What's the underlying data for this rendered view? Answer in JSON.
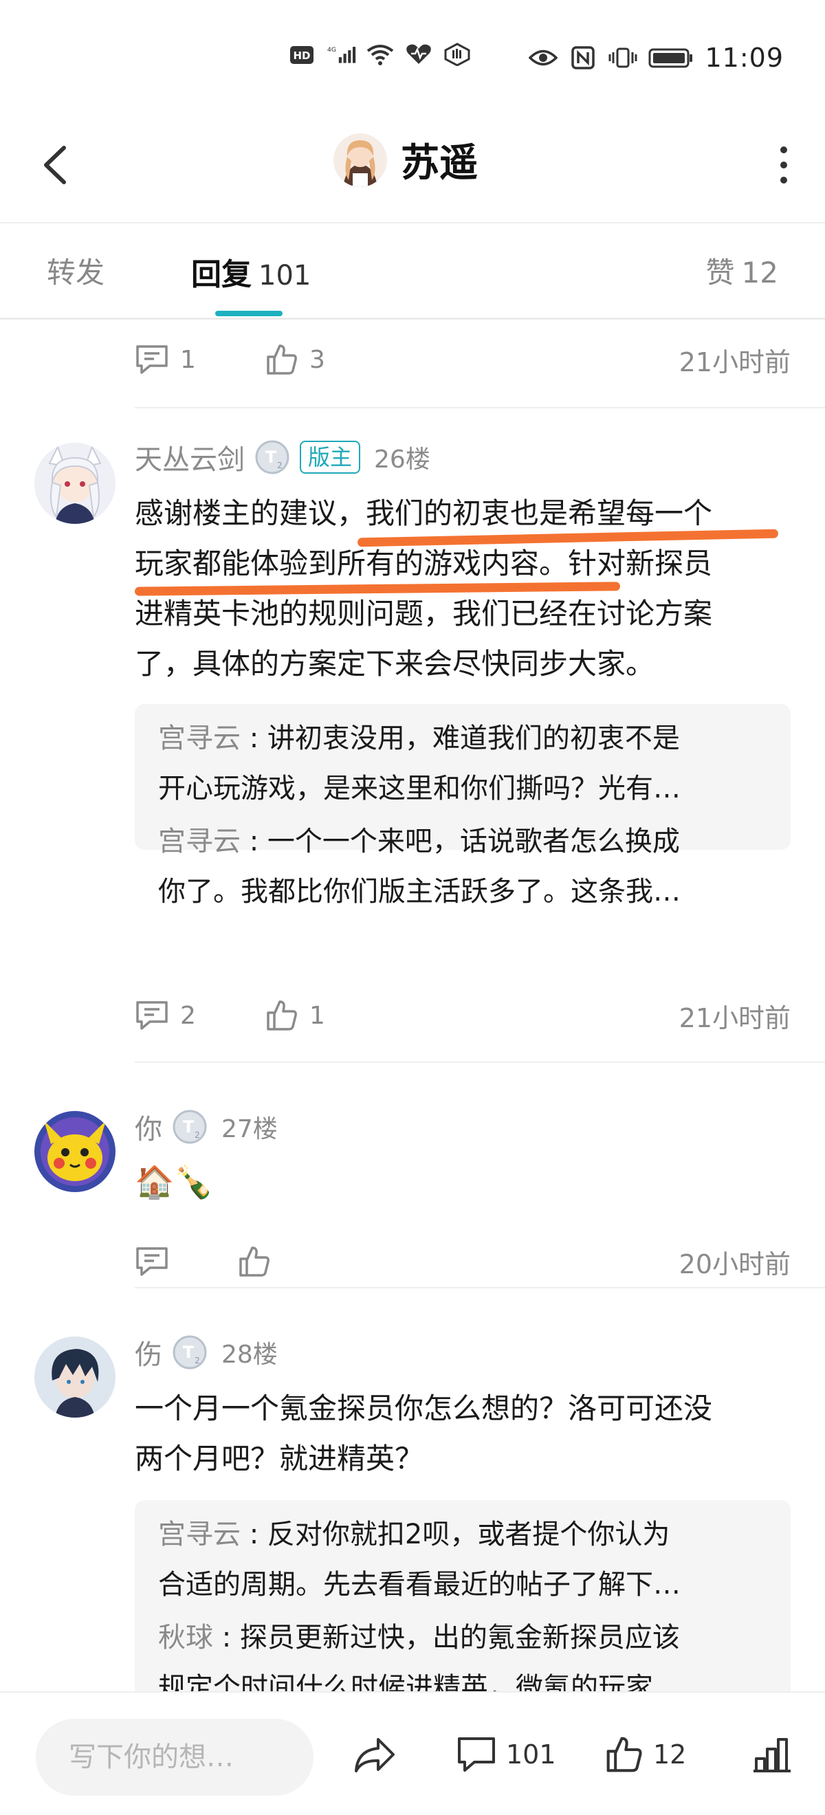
{
  "status_bar": {
    "icons_left": [
      "hd-icon",
      "signal-4g-icon",
      "wifi-icon",
      "heart-health-icon",
      "hand-icon"
    ],
    "icons_right": [
      "eye-comfort-icon",
      "nfc-icon",
      "vibrate-icon",
      "battery-icon"
    ],
    "time": "11:09"
  },
  "header": {
    "title": "苏遥",
    "back_icon": "chevron-left-icon",
    "more_icon": "more-vertical-icon"
  },
  "tabs": {
    "forward": "转发",
    "reply": "回复",
    "reply_count": "101",
    "like": "赞",
    "like_count": "12",
    "accent": "#1eb1c0"
  },
  "top_actions": {
    "comments": "1",
    "likes": "3",
    "time": "21小时前"
  },
  "posts": [
    {
      "author": "天丛云剑",
      "role": "版主",
      "floor": "26楼",
      "lines": [
        "感谢楼主的建议，我们的初衷也是希望每一个",
        "玩家都能体验到所有的游戏内容。针对新探员",
        "进精英卡池的规则问题，我们已经在讨论方案",
        "了，具体的方案定下来会尽快同步大家。"
      ],
      "replies": [
        {
          "name": "宫寻云",
          "line1": "讲初衷没用，难道我们的初衷不是",
          "line2": "开心玩游戏，是来这里和你们撕吗？光有…"
        },
        {
          "name": "宫寻云",
          "line1": "一个一个来吧，话说歌者怎么换成",
          "line2": "你了。我都比你们版主活跃多了。这条我…"
        }
      ],
      "comments": "2",
      "likes": "1",
      "time": "21小时前"
    },
    {
      "author": "你",
      "floor": "27楼",
      "text": "🏠🍾",
      "time": "20小时前"
    },
    {
      "author": "伤",
      "floor": "28楼",
      "lines": [
        "一个月一个氪金探员你怎么想的？洛可可还没",
        "两个月吧？就进精英？"
      ],
      "replies": [
        {
          "name": "宫寻云",
          "line1": "反对你就扣2呗，或者提个你认为",
          "line2": "合适的周期。先去看看最近的帖子了解下…"
        },
        {
          "name": "秋球",
          "line1": "探员更新过快，出的氪金新探员应该",
          "line2": "规定个时间什么时候进精英，微氪的玩家"
        }
      ]
    }
  ],
  "bottom_bar": {
    "compose_placeholder": "写下你的想…",
    "comment_count": "101",
    "like_count": "12"
  },
  "colors": {
    "accent": "#1eb1c0",
    "highlight": "#f3661f",
    "muted_text": "#8b8b8b"
  }
}
